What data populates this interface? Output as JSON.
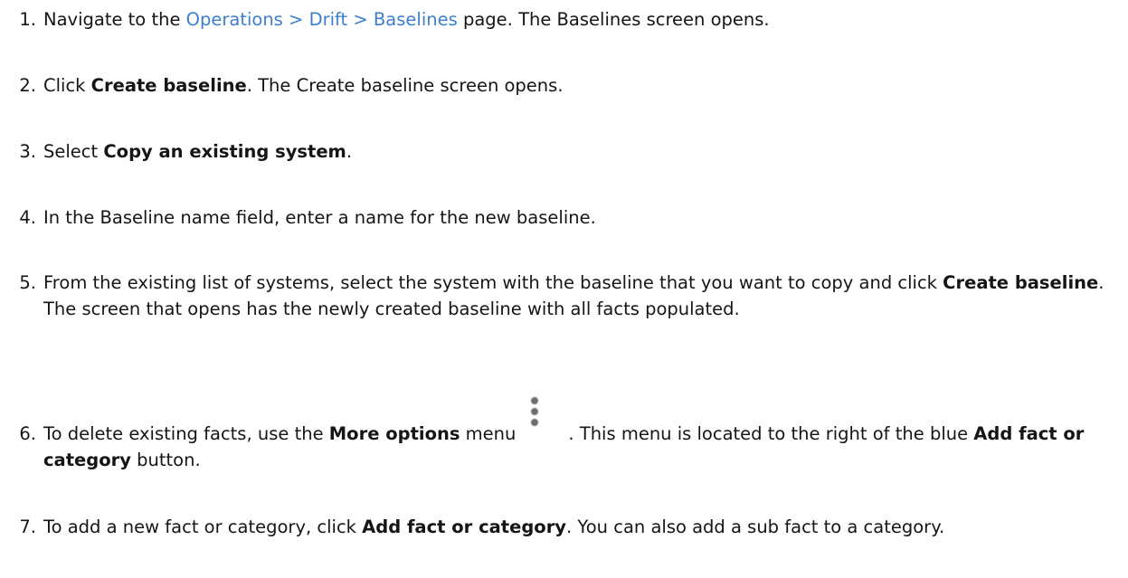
{
  "steps": [
    {
      "number": "1.",
      "before": "Navigate to the ",
      "link": "Operations > Drift > Baselines",
      "after": " page. The Baselines screen opens."
    },
    {
      "number": "2.",
      "before": "Click ",
      "bold": "Create baseline",
      "after": ". The Create baseline screen opens."
    },
    {
      "number": "3.",
      "before": "Select ",
      "bold": "Copy an existing system",
      "after": "."
    },
    {
      "number": "4.",
      "text": "In the Baseline name field, enter a name for the new baseline."
    },
    {
      "number": "5.",
      "before": "From the existing list of systems, select the system with the baseline that you want to copy and click ",
      "bold": "Create baseline",
      "after": ". The screen that opens has the newly created baseline with all facts populated."
    },
    {
      "number": "6.",
      "before": "To delete existing facts, use the ",
      "bold": "More options",
      "middle": " menu",
      "after": ". This menu is located to the right of the blue ",
      "bold2": "Add fact or category",
      "end": " button."
    },
    {
      "number": "7.",
      "before": "To add a new fact or category, click ",
      "bold": "Add fact or category",
      "after": ". You can also add a sub fact to a category."
    }
  ],
  "icons": {
    "more_options": "kebab-vertical-icon"
  },
  "colors": {
    "link": "#3d7fcf",
    "text": "#151515",
    "icon": "#6a6e73"
  }
}
